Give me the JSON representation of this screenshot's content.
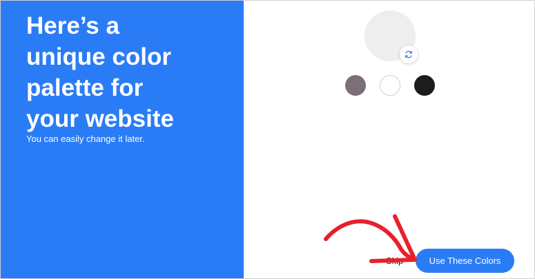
{
  "intro": {
    "headline_lines": [
      "Here’s a",
      "unique color",
      "palette for",
      "your website"
    ],
    "subtitle": "You can easily change it later."
  },
  "palette": {
    "preview_color": "#eeeeee",
    "refresh_icon": "refresh-icon",
    "swatches": [
      {
        "color": "#7d6f77"
      },
      {
        "color": "#ffffff"
      },
      {
        "color": "#1c1c1c"
      }
    ]
  },
  "actions": {
    "skip_label": "Skip",
    "use_label": "Use These Colors"
  },
  "theme": {
    "accent": "#2a7cf6",
    "annotation": "#e8202a"
  }
}
